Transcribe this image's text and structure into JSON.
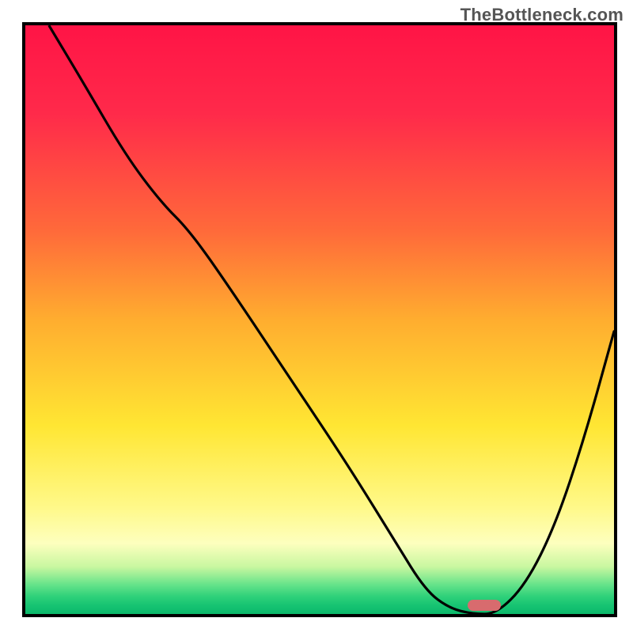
{
  "watermark": "TheBottleneck.com",
  "chart_data": {
    "type": "line",
    "title": "",
    "xlabel": "",
    "ylabel": "",
    "xlim": [
      0,
      100
    ],
    "ylim": [
      0,
      100
    ],
    "grid": false,
    "legend": false,
    "series": [
      {
        "name": "curve",
        "x": [
          4,
          10,
          17,
          23,
          28,
          35,
          45,
          55,
          63,
          68,
          72,
          76,
          80,
          85,
          90,
          95,
          100
        ],
        "y": [
          100,
          90,
          78,
          70,
          65,
          55,
          40,
          25,
          12,
          4,
          1,
          0,
          0,
          5,
          15,
          30,
          48
        ]
      }
    ],
    "marker": {
      "x": 78,
      "y": 1.5,
      "shape": "pill",
      "color": "#d86b6e"
    },
    "background_gradient": {
      "stops": [
        {
          "pct": 0,
          "color": "#ff1446"
        },
        {
          "pct": 15,
          "color": "#ff2a4a"
        },
        {
          "pct": 35,
          "color": "#ff6a3a"
        },
        {
          "pct": 50,
          "color": "#ffad2f"
        },
        {
          "pct": 68,
          "color": "#ffe633"
        },
        {
          "pct": 82,
          "color": "#fff98a"
        },
        {
          "pct": 88,
          "color": "#fdffbe"
        },
        {
          "pct": 92,
          "color": "#c8f7a0"
        },
        {
          "pct": 95,
          "color": "#66e38a"
        },
        {
          "pct": 97,
          "color": "#2fd17a"
        },
        {
          "pct": 98.5,
          "color": "#17c472"
        },
        {
          "pct": 100,
          "color": "#0bb96b"
        }
      ]
    }
  }
}
